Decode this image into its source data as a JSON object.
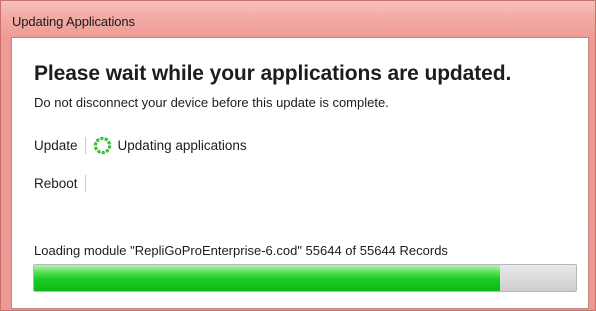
{
  "window": {
    "title": "Updating Applications"
  },
  "main": {
    "heading": "Please wait while your applications are updated.",
    "subheading": "Do not disconnect your device before this update is complete."
  },
  "steps": [
    {
      "label": "Update",
      "status_icon": "spinner-icon",
      "status_text": "Updating applications"
    },
    {
      "label": "Reboot",
      "status_text": ""
    }
  ],
  "progress": {
    "message": "Loading module \"RepliGoProEnterprise-6.cod\" 55644 of 55644 Records",
    "fraction": 0.86
  },
  "colors": {
    "title_bar": "#f2aaa5",
    "progress_fill": "#18cc24",
    "spinner": "#1db51d"
  }
}
